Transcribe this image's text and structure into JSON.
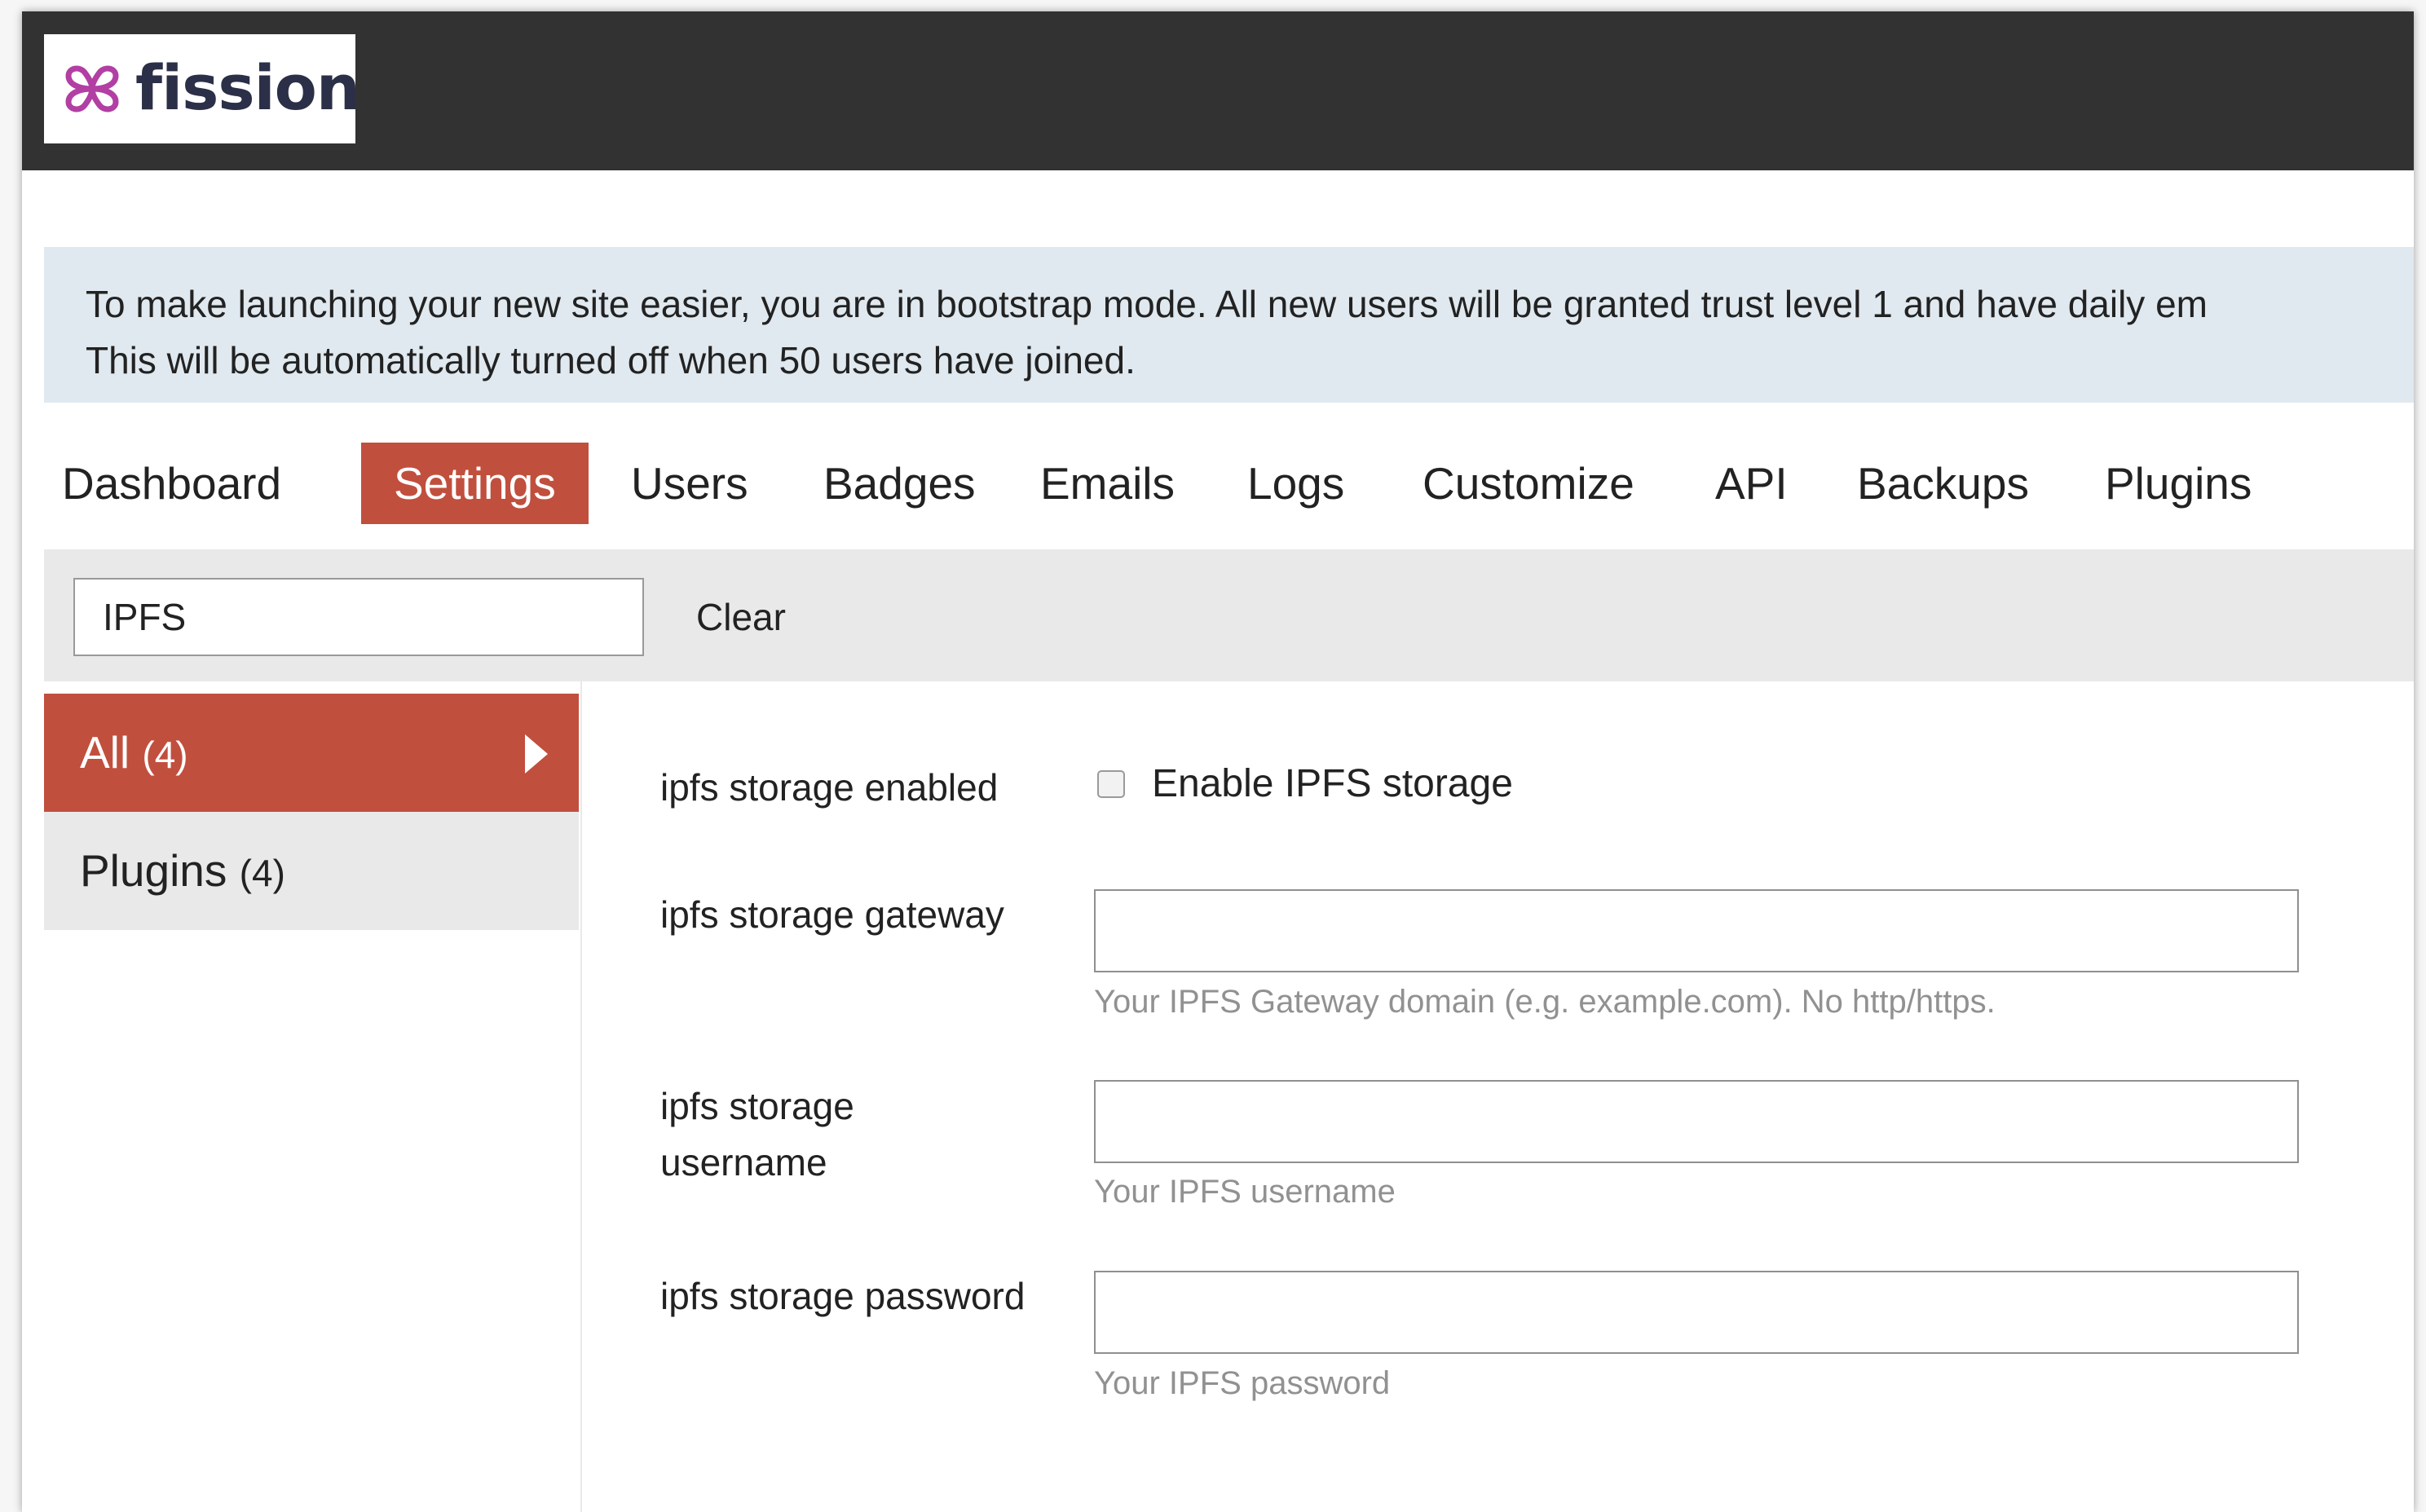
{
  "brand": {
    "name": "fission",
    "colors": {
      "accent": "#c14f3e",
      "header": "#323232",
      "banner": "#e0e9ef",
      "logo_mark": "#b23fa3",
      "logo_text": "#2b2f47"
    }
  },
  "banner": {
    "line1": "To make launching your new site easier, you are in bootstrap mode. All new users will be granted trust level 1 and have daily em",
    "line2": "This will be automatically turned off when 50 users have joined."
  },
  "nav": {
    "tabs": [
      {
        "label": "Dashboard",
        "active": false
      },
      {
        "label": "Settings",
        "active": true
      },
      {
        "label": "Users",
        "active": false
      },
      {
        "label": "Badges",
        "active": false
      },
      {
        "label": "Emails",
        "active": false
      },
      {
        "label": "Logs",
        "active": false
      },
      {
        "label": "Customize",
        "active": false
      },
      {
        "label": "API",
        "active": false
      },
      {
        "label": "Backups",
        "active": false
      },
      {
        "label": "Plugins",
        "active": false
      }
    ]
  },
  "filter": {
    "value": "IPFS",
    "clear_label": "Clear"
  },
  "sidebar": {
    "items": [
      {
        "label": "All",
        "count": "(4)",
        "active": true
      },
      {
        "label": "Plugins",
        "count": "(4)",
        "active": false
      }
    ]
  },
  "settings": {
    "enabled": {
      "label": "ipfs storage enabled",
      "checkbox_label": "Enable IPFS storage",
      "checked": false
    },
    "gateway": {
      "label": "ipfs storage gateway",
      "value": "",
      "help": "Your IPFS Gateway domain (e.g. example.com). No http/https."
    },
    "username": {
      "label_line1": "ipfs storage",
      "label_line2": "username",
      "value": "",
      "help": "Your IPFS username"
    },
    "password": {
      "label": "ipfs storage password",
      "value": "",
      "help": "Your IPFS password"
    }
  }
}
